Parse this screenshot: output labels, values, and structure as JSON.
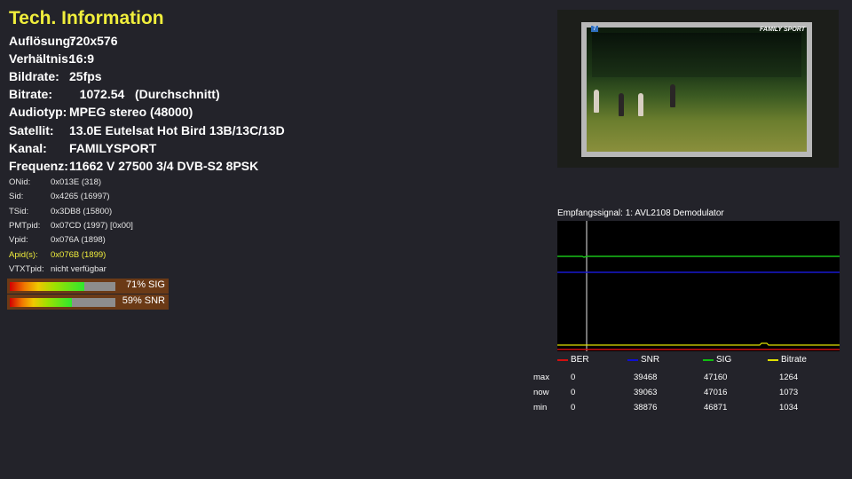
{
  "title": "Tech. Information",
  "info": [
    {
      "label": "Auflösung:",
      "value": "720x576"
    },
    {
      "label": "Verhältnis:",
      "value": "16:9"
    },
    {
      "label": "Bildrate:",
      "value": "25fps"
    },
    {
      "label": "Bitrate:",
      "value": "   1072.54   (Durchschnitt)"
    },
    {
      "label": "Audiotyp:",
      "value": "MPEG stereo (48000)"
    },
    {
      "label": "Satellit:",
      "value": "13.0E Eutelsat Hot Bird 13B/13C/13D"
    },
    {
      "label": "Kanal:",
      "value": "FAMILYSPORT"
    },
    {
      "label": "Frequenz:",
      "value": "11662 V 27500 3/4 DVB-S2 8PSK"
    }
  ],
  "pids": [
    {
      "label": "ONid:",
      "value": "0x013E (318)"
    },
    {
      "label": "Sid:",
      "value": "0x4265 (16997)"
    },
    {
      "label": "TSid:",
      "value": "0x3DB8 (15800)"
    },
    {
      "label": "PMTpid:",
      "value": "0x07CD (1997) [0x00]"
    },
    {
      "label": "Vpid:",
      "value": "0x076A (1898)"
    },
    {
      "label": "Apid(s):",
      "value": "0x076B (1899)"
    },
    {
      "label": "VTXTpid:",
      "value": "nicht verfügbar"
    }
  ],
  "meters": [
    {
      "text": "71% SIG",
      "fraction": 0.71
    },
    {
      "text": "59% SNR",
      "fraction": 0.59
    }
  ],
  "video": {
    "channel_number": "7",
    "channel_logo": "FAMILY SPORT"
  },
  "graph": {
    "title": "Empfangssignal: 1: AVL2108 Demodulator",
    "legend": [
      {
        "name": "BER",
        "color": "#d01010"
      },
      {
        "name": "SNR",
        "color": "#1010d0"
      },
      {
        "name": "SIG",
        "color": "#10c010"
      },
      {
        "name": "Bitrate",
        "color": "#e0e000"
      }
    ]
  },
  "stats": {
    "rows": [
      {
        "label": "max",
        "values": [
          "0",
          "39468",
          "47160",
          "1264"
        ]
      },
      {
        "label": "now",
        "values": [
          "0",
          "39063",
          "47016",
          "1073"
        ]
      },
      {
        "label": "min",
        "values": [
          "0",
          "38876",
          "46871",
          "1034"
        ]
      }
    ]
  }
}
